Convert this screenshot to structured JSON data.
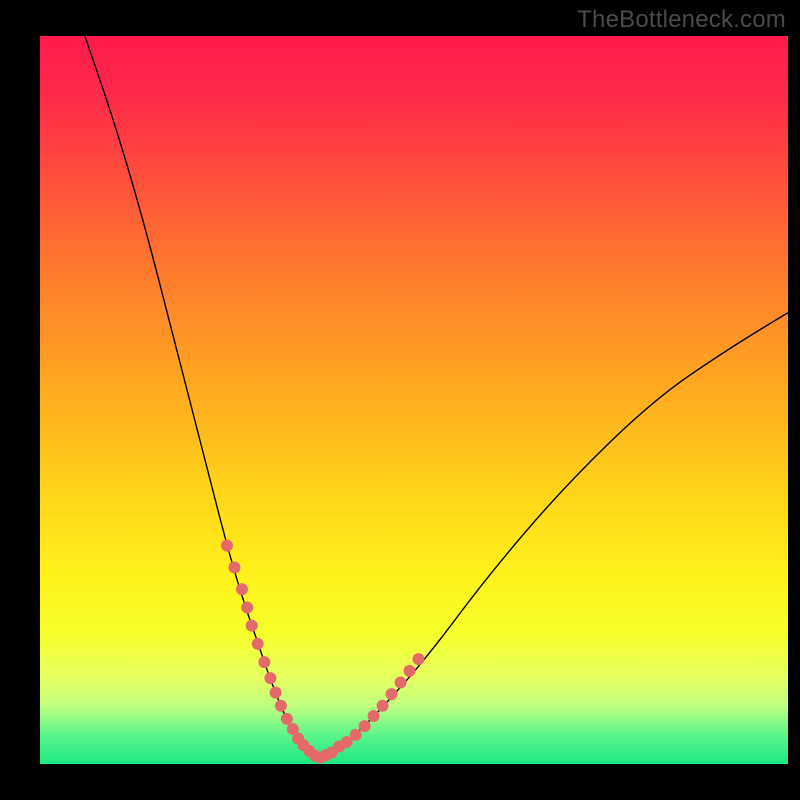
{
  "watermark": "TheBottleneck.com",
  "chart_data": {
    "type": "line",
    "title": "",
    "xlabel": "",
    "ylabel": "",
    "xlim": [
      0,
      100
    ],
    "ylim": [
      0,
      100
    ],
    "grid": false,
    "series": [
      {
        "name": "bottleneck-curve",
        "x": [
          6,
          10,
          14,
          18,
          22,
          25,
          27,
          29,
          31,
          33,
          34.5,
          36,
          37.5,
          39,
          42,
          46,
          52,
          60,
          70,
          82,
          92,
          100
        ],
        "y": [
          100,
          88,
          74,
          58,
          42,
          30,
          23,
          17,
          11,
          6,
          3.5,
          1.8,
          0.9,
          1.6,
          3.8,
          8,
          15,
          26,
          38,
          50,
          57,
          62
        ]
      }
    ],
    "highlight_points": {
      "name": "marker-dots",
      "color": "#e46a6a",
      "x": [
        25,
        26,
        27,
        27.7,
        28.3,
        29.1,
        30,
        30.8,
        31.5,
        32.2,
        33,
        33.8,
        34.5,
        35.2,
        36,
        36.8,
        37.5,
        38.2,
        39,
        40,
        41,
        42.2,
        43.4,
        44.6,
        45.8,
        47,
        48.2,
        49.4,
        50.6
      ],
      "y": [
        30,
        27,
        24,
        21.5,
        19,
        16.5,
        14,
        11.8,
        9.8,
        8,
        6.2,
        4.8,
        3.5,
        2.6,
        1.8,
        1.1,
        0.9,
        1.2,
        1.6,
        2.4,
        3.0,
        4.0,
        5.2,
        6.6,
        8.0,
        9.6,
        11.2,
        12.8,
        14.4
      ]
    },
    "background_gradient": {
      "top": "#ff1a4d",
      "bottom": "#1de884"
    }
  }
}
